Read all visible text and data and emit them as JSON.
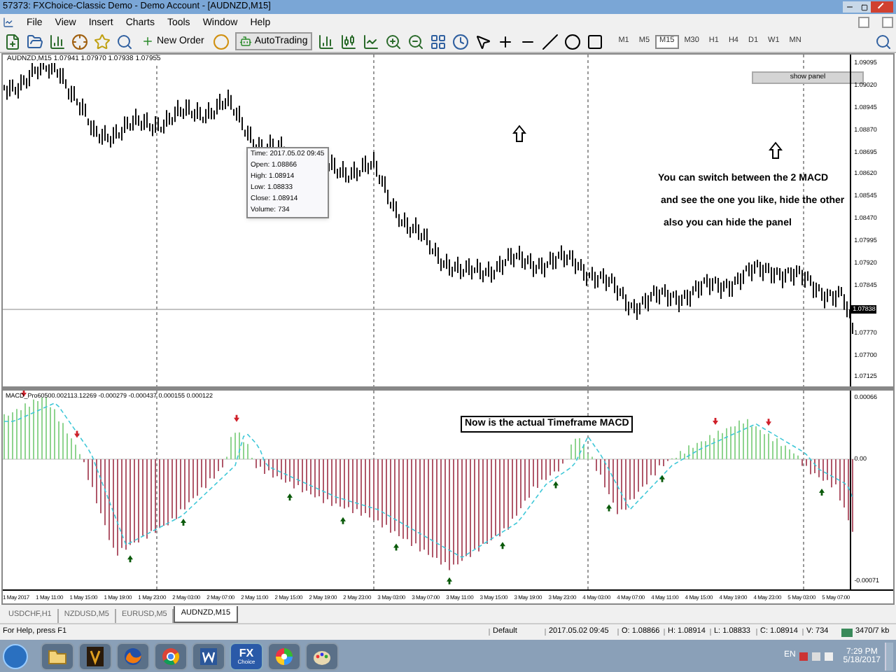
{
  "window": {
    "title": "57373: FXChoice-Classic Demo - Demo Account - [AUDNZD,M15]"
  },
  "menu": [
    "File",
    "View",
    "Insert",
    "Charts",
    "Tools",
    "Window",
    "Help"
  ],
  "toolbar": {
    "new_order": "New Order",
    "autotrading": "AutoTrading",
    "timeframes": [
      {
        "label": "M1",
        "selected": false
      },
      {
        "label": "M5",
        "selected": false
      },
      {
        "label": "M15",
        "selected": true
      },
      {
        "label": "M30",
        "selected": false
      },
      {
        "label": "H1",
        "selected": false
      },
      {
        "label": "H4",
        "selected": false
      },
      {
        "label": "D1",
        "selected": false
      },
      {
        "label": "W1",
        "selected": false
      },
      {
        "label": "MN",
        "selected": false
      }
    ]
  },
  "chart": {
    "header": "AUDNZD,M15  1.07941 1.07970 1.07938 1.07955",
    "price_labels": [
      "1.09095",
      "1.09020",
      "1.08945",
      "1.08870",
      "1.08695",
      "1.08620",
      "1.08545",
      "1.08470",
      "1.07995",
      "1.07920",
      "1.07845",
      "1.07770",
      "1.07700",
      "1.07125"
    ],
    "current_price": "1.07838",
    "tooltip": [
      "Time: 2017.05.02 09:45",
      "Open: 1.08866",
      "High: 1.08914",
      "Low: 1.08833",
      "Close: 1.08914",
      "Volume: 734"
    ],
    "show_panel": "show panel",
    "notes": [
      "You can switch between the 2 MACD",
      "and see the one you like, hide the other",
      "also you can hide the panel"
    ],
    "indicator": {
      "header": "MACD_Pro60500.002113.12269 -0.000279 -0.000437 0.000155 0.000122",
      "note": "Now is the actual Timeframe MACD",
      "levels": [
        "0.00066",
        "0.00",
        "-0.00071"
      ]
    },
    "time_labels": [
      "1 May 2017",
      "1 May 11:00",
      "1 May 15:00",
      "1 May 19:00",
      "1 May 23:00",
      "2 May 03:00",
      "2 May 07:00",
      "2 May 11:00",
      "2 May 15:00",
      "2 May 19:00",
      "2 May 23:00",
      "3 May 03:00",
      "3 May 07:00",
      "3 May 11:00",
      "3 May 15:00",
      "3 May 19:00",
      "3 May 23:00",
      "4 May 03:00",
      "4 May 07:00",
      "4 May 11:00",
      "4 May 15:00",
      "4 May 19:00",
      "4 May 23:00",
      "5 May 03:00",
      "5 May 07:00"
    ]
  },
  "tabs": [
    {
      "label": "USDCHF,H1",
      "selected": false
    },
    {
      "label": "NZDUSD,M5",
      "selected": false
    },
    {
      "label": "EURUSD,M5",
      "selected": false
    },
    {
      "label": "AUDNZD,M15",
      "selected": true
    }
  ],
  "status_bar": {
    "help": "For Help, press F1",
    "profile": "Default",
    "time": "2017.05.02 09:45",
    "open": "O: 1.08866",
    "high": "H: 1.08914",
    "low": "L: 1.08833",
    "close": "C: 1.08914",
    "volume": "V: 734",
    "traffic": "3470/7 kb"
  },
  "taskbar": {
    "apps": [
      {
        "kind": "folder"
      },
      {
        "kind": "emblem"
      },
      {
        "kind": "firefox"
      },
      {
        "kind": "chrome"
      },
      {
        "kind": "word"
      },
      {
        "kind": "fx",
        "label": "FX",
        "sublabel": "Choice"
      },
      {
        "kind": "picasa"
      },
      {
        "kind": "paint"
      }
    ],
    "language": "EN",
    "time": "7:29 PM",
    "date": "5/18/2017"
  }
}
